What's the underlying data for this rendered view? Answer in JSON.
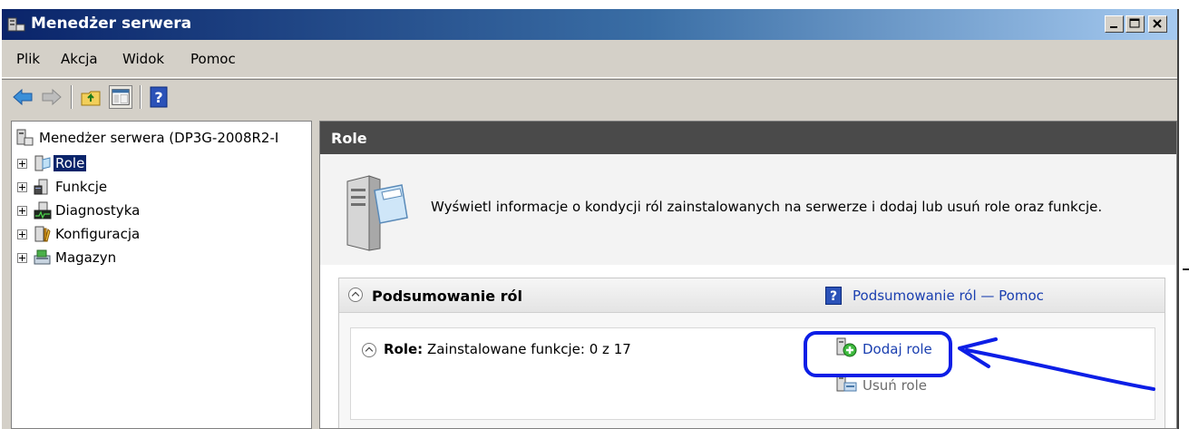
{
  "window": {
    "title": "Menedżer serwera",
    "buttons": {
      "minimize": "minimize",
      "maximize": "maximize",
      "close": "close"
    }
  },
  "menubar": {
    "items": [
      "Plik",
      "Akcja",
      "Widok",
      "Pomoc"
    ]
  },
  "toolbar": {
    "icons": [
      "back-arrow-icon",
      "forward-arrow-icon",
      "up-folder-icon",
      "show-hide-tree-icon",
      "help-icon"
    ]
  },
  "tree": {
    "root_label": "Menedżer serwera (DP3G-2008R2-I",
    "items": [
      {
        "label": "Role",
        "selected": true
      },
      {
        "label": "Funkcje",
        "selected": false
      },
      {
        "label": "Diagnostyka",
        "selected": false
      },
      {
        "label": "Konfiguracja",
        "selected": false
      },
      {
        "label": "Magazyn",
        "selected": false
      }
    ]
  },
  "content": {
    "header": "Role",
    "intro_text": "Wyświetl informacje o kondycji ról zainstalowanych na serwerze i dodaj lub usuń role oraz funkcje.",
    "summary": {
      "title": "Podsumowanie ról",
      "help_label": "Podsumowanie ról — Pomoc",
      "roles": {
        "label": "Role:",
        "status": "Zainstalowane funkcje: 0 z 17",
        "actions": [
          "Dodaj role",
          "Usuń role"
        ]
      }
    }
  },
  "colors": {
    "title_gradient_start": "#0a246a",
    "title_gradient_end": "#a6caf0",
    "header_dark": "#4a4a4a",
    "link_blue": "#1a3fb0",
    "annotation_blue": "#0c1ee6"
  }
}
